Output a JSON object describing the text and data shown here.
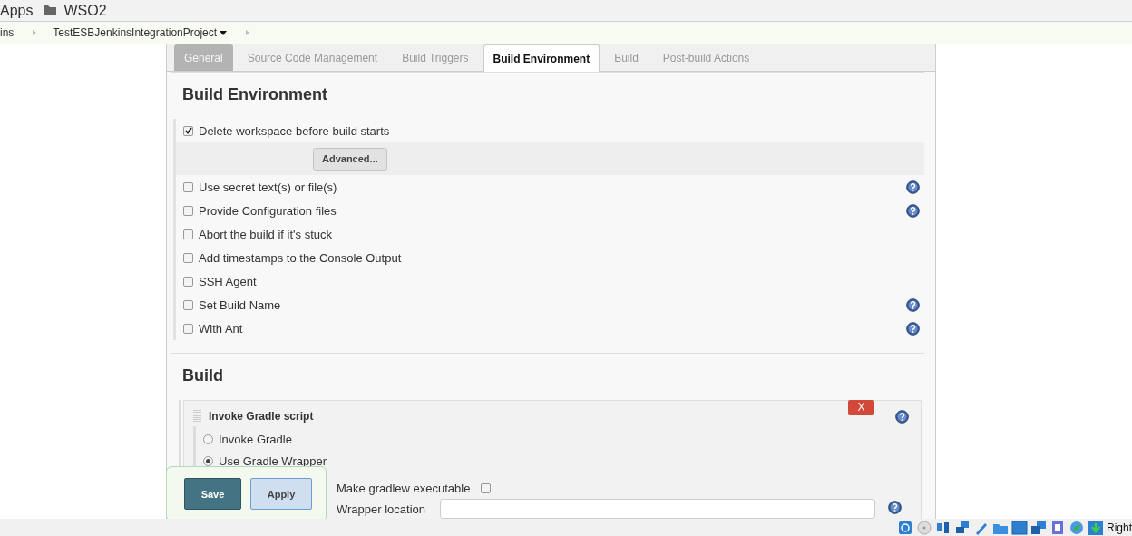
{
  "bookmarks": [
    {
      "kind": "apps",
      "label": "Apps"
    },
    {
      "kind": "folder",
      "label": "WSO2"
    }
  ],
  "breadcrumbs": [
    {
      "label": "ins",
      "dropdown": false
    },
    {
      "label": "TestESBJenkinsIntegrationProject",
      "dropdown": true
    }
  ],
  "tabs": [
    {
      "label": "General",
      "selected": false,
      "hovered": true
    },
    {
      "label": "Source Code Management",
      "selected": false,
      "hovered": false
    },
    {
      "label": "Build Triggers",
      "selected": false,
      "hovered": false
    },
    {
      "label": "Build Environment",
      "selected": true,
      "hovered": false
    },
    {
      "label": "Build",
      "selected": false,
      "hovered": false
    },
    {
      "label": "Post-build Actions",
      "selected": false,
      "hovered": false
    }
  ],
  "build_environment": {
    "title": "Build Environment",
    "options": [
      {
        "label": "Delete workspace before build starts",
        "checked": true,
        "help": false,
        "button": "Advanced..."
      },
      {
        "label": "Use secret text(s) or file(s)",
        "checked": false,
        "help": true
      },
      {
        "label": "Provide Configuration files",
        "checked": false,
        "help": true
      },
      {
        "label": "Abort the build if it's stuck",
        "checked": false,
        "help": false
      },
      {
        "label": "Add timestamps to the Console Output",
        "checked": false,
        "help": false
      },
      {
        "label": "SSH Agent",
        "checked": false,
        "help": false
      },
      {
        "label": "Set Build Name",
        "checked": false,
        "help": true
      },
      {
        "label": "With Ant",
        "checked": false,
        "help": true
      }
    ]
  },
  "build": {
    "title": "Build",
    "step": {
      "title": "Invoke Gradle script",
      "delete_button": "X",
      "choices": [
        {
          "label": "Invoke Gradle",
          "selected": false
        },
        {
          "label": "Use Gradle Wrapper",
          "selected": true
        }
      ],
      "checkbox": {
        "label": "Make gradlew executable",
        "checked": false
      },
      "field": {
        "label": "Wrapper location"
      }
    }
  },
  "save_bar": {
    "buttons": [
      {
        "kind": "primary",
        "label": "Save"
      },
      {
        "kind": "secondary",
        "label": "Apply"
      }
    ]
  },
  "status_bar": {
    "host_key": "Right"
  }
}
